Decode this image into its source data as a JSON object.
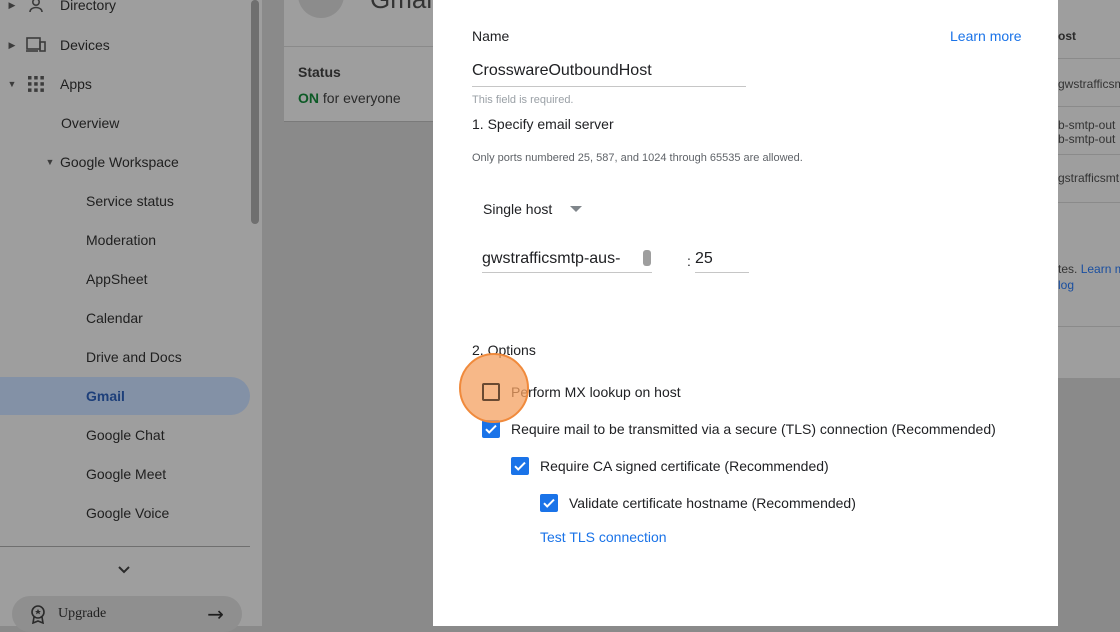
{
  "sidebar": {
    "directory": "Directory",
    "devices": "Devices",
    "apps": "Apps",
    "overview": "Overview",
    "workspace": "Google Workspace",
    "items": [
      "Service status",
      "Moderation",
      "AppSheet",
      "Calendar",
      "Drive and Docs",
      "Gmail",
      "Google Chat",
      "Google Meet",
      "Google Voice"
    ],
    "selected": "Gmail",
    "upgrade": "Upgrade"
  },
  "background": {
    "app_title_partial": "Gmail",
    "status_label": "Status",
    "status_on": "ON",
    "status_rest": "for everyone",
    "table_header_partial": "ost",
    "rows": [
      "gwstrafficsm",
      "b-smtp-out",
      "b-smtp-out",
      "gstrafficsmt"
    ],
    "note_partial": "tes.",
    "learn_partial": "Learn m",
    "log_partial": "log"
  },
  "dialog": {
    "name_label": "Name",
    "learn_more": "Learn more",
    "name_value": "CrosswareOutboundHost",
    "required_hint": "This field is required.",
    "section1": "1. Specify email server",
    "ports_note": "Only ports numbered 25, 587, and 1024 through 65535 are allowed.",
    "host_type": "Single host",
    "host_value": "gwstrafficsmtp-aus-",
    "port_sep": ":",
    "port_value": "25",
    "section2": "2. Options",
    "options": [
      {
        "label": "Perform MX lookup on host",
        "checked": false
      },
      {
        "label": "Require mail to be transmitted via a secure (TLS) connection (Recommended)",
        "checked": true
      },
      {
        "label": "Require CA signed certificate (Recommended)",
        "checked": true
      },
      {
        "label": "Validate certificate hostname (Recommended)",
        "checked": true
      }
    ],
    "test_tls": "Test TLS connection"
  },
  "colors": {
    "accent": "#1a73e8",
    "highlight": "#f08a3c",
    "on_green": "#137333"
  }
}
